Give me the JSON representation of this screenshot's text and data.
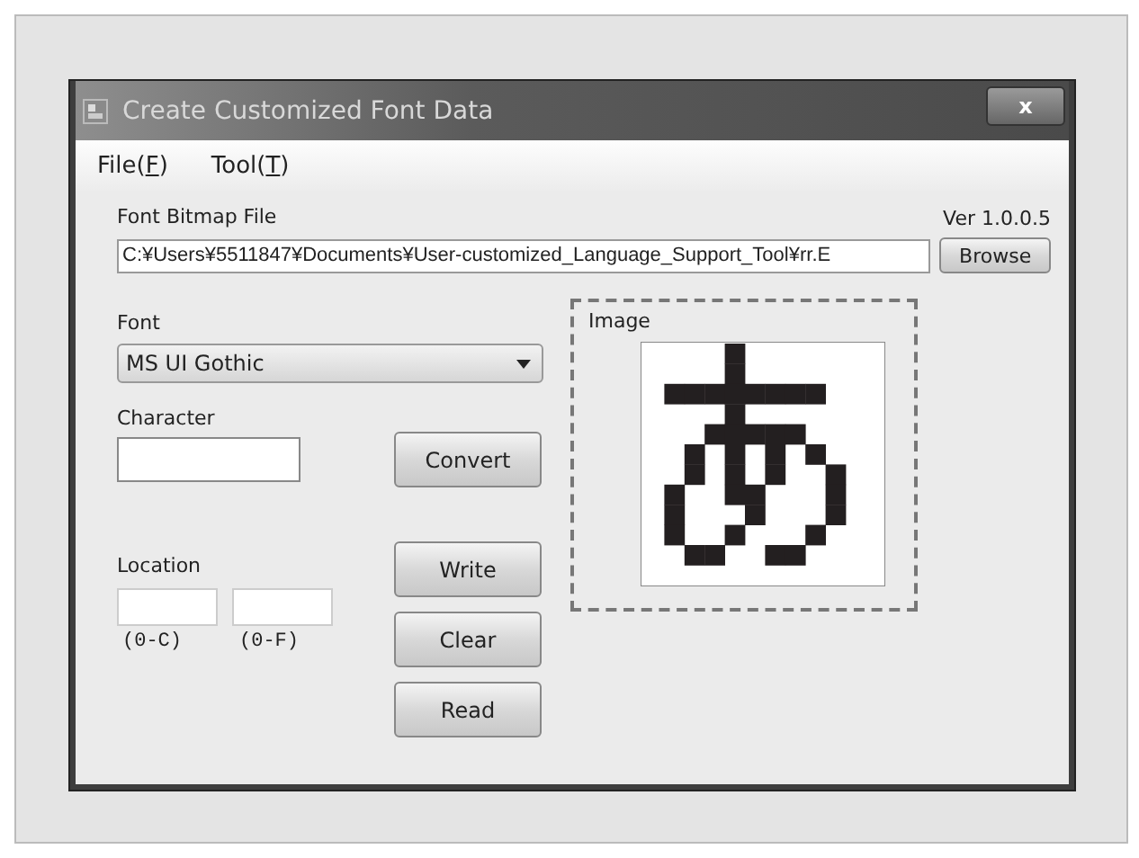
{
  "window": {
    "title": "Create Customized Font Data",
    "close": "x"
  },
  "menu": [
    {
      "text": "File(",
      "mnemonic": "F",
      "close": ")"
    },
    {
      "text": "Tool(",
      "mnemonic": "T",
      "close": ")"
    }
  ],
  "version": "Ver 1.0.0.5",
  "bitmap_file": {
    "label": "Font Bitmap File",
    "value": "C:¥Users¥5511847¥Documents¥User-customized_Language_Support_Tool¥rr.E",
    "button": "Browse"
  },
  "font": {
    "label": "Font",
    "value": "MS UI Gothic"
  },
  "character": {
    "label": "Character"
  },
  "location": {
    "label": "Location",
    "hints": [
      "(0-C)",
      "(0-F)"
    ]
  },
  "buttons": {
    "convert": "Convert",
    "write": "Write",
    "clear": "Clear",
    "read": "Read"
  },
  "image": {
    "label": "Image"
  }
}
